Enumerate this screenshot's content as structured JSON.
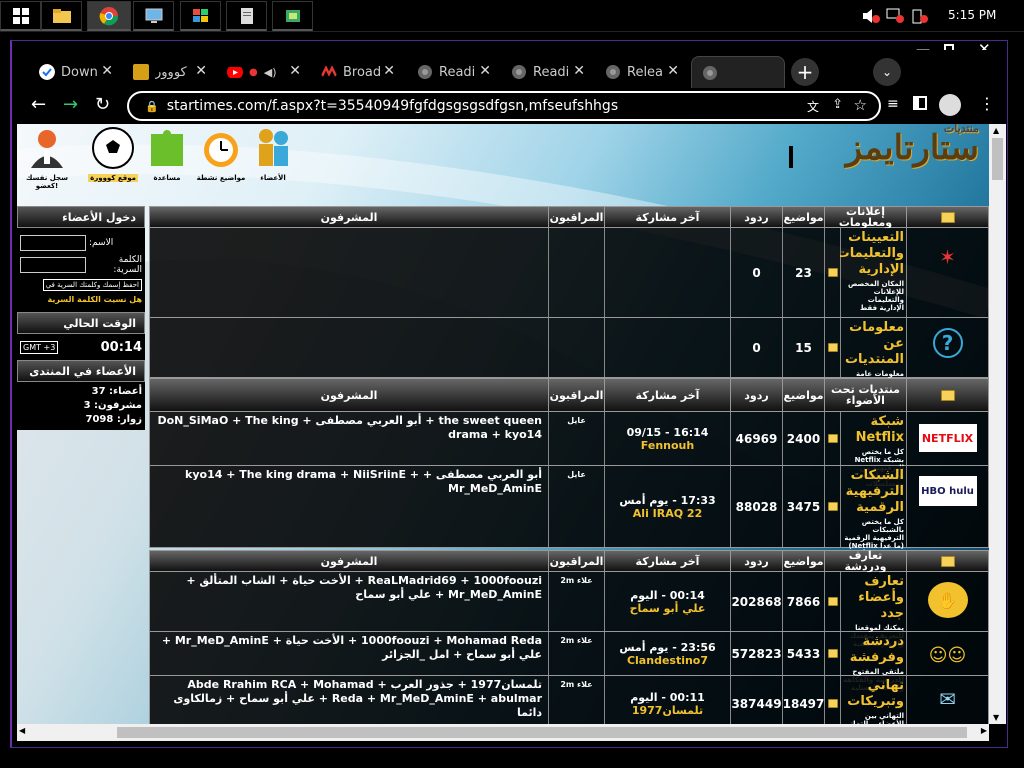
{
  "taskbar": {
    "time": "5:15 PM"
  },
  "browser": {
    "tabs": [
      {
        "title": "Down",
        "icon": "check-circle-icon",
        "color": "#1a73e8"
      },
      {
        "title": "كووور",
        "icon": "koora-icon",
        "color": "#d4a017"
      },
      {
        "title": "",
        "icon": "youtube-icon",
        "color": "#ff0000"
      },
      {
        "title": "Broad",
        "icon": "broadcast-icon",
        "color": "#e53935"
      },
      {
        "title": "Readi",
        "icon": "globe-icon",
        "color": "#777777"
      },
      {
        "title": "Readi",
        "icon": "globe-icon",
        "color": "#777777"
      },
      {
        "title": "Relea",
        "icon": "globe-icon",
        "color": "#777777"
      },
      {
        "title": "",
        "icon": "globe-icon",
        "color": "#777777"
      }
    ],
    "url": "startimes.com/f.aspx?t=35540949fgfdgsgsgsdfgsn,mfseufshhgs"
  },
  "site": {
    "logo_small": "منتديات",
    "logo": "ستارتايمز",
    "top_icons": [
      {
        "label": "الأعضاء",
        "icon": "members-icon",
        "color": "#e0a21a"
      },
      {
        "label": "مواضيع نشطة",
        "icon": "alarm-clock-icon",
        "color": "#f08b1a"
      },
      {
        "label": "مساعدة",
        "icon": "puzzle-icon",
        "color": "#6bbf2a"
      },
      {
        "label": "موقع كووورة",
        "icon": "football-icon",
        "color": "#ffffff"
      },
      {
        "label": "سجل نفسك كعضو!",
        "icon": "user-register-icon",
        "color": "#e8662a"
      }
    ]
  },
  "sidebar": {
    "login_title": "دخول الأعضاء",
    "name_label": "الاسم:",
    "password_label": "الكلمة السرية:",
    "remember_label": "احفظ إسمك وكلمتك السرية في",
    "forgot_label": "هل نسيت الكلمة السرية",
    "time_title": "الوقت الحالي",
    "time_value": "00:14",
    "gmt_label": "GMT +3",
    "online_title": "الأعضاء في المنتدى",
    "members_label": "أعضاء:",
    "members_value": "37",
    "supervisors_label": "مشرفون:",
    "supervisors_value": "3",
    "visitors_label": "زوار:",
    "visitors_value": "7098"
  },
  "columns": {
    "topics": "مواضيع",
    "replies": "ردود",
    "last_post": "آخر مشاركة",
    "moderators": "المراقبون",
    "managers": "المشرفون"
  },
  "sections": [
    {
      "title": "إعلانات ومعلومات",
      "forums": [
        {
          "name": "التعيينات والتعليمات الإدارية",
          "desc": "المكان المخصص للإعلانات والتعليمات الإدارية فقط",
          "icon": "announcement-icon",
          "icon_text": "",
          "topics": "23",
          "replies": "0",
          "last_date": "",
          "last_user": "",
          "moderator": "",
          "managers": ""
        },
        {
          "name": "معلومات عن المنتديات",
          "desc": "معلومات عامة عن الإدارة للزوار والأعضاء الكرام",
          "icon": "question-icon",
          "icon_text": "?",
          "topics": "15",
          "replies": "0",
          "last_date": "",
          "last_user": "",
          "moderator": "",
          "managers": ""
        }
      ]
    },
    {
      "title": "منتديات تحت الأضواء",
      "forums": [
        {
          "name": "شبكة Netflix",
          "desc": "كل ما يختص بشبكة Netflix الترفيهية من برامج وأفلام ومسلسلات",
          "icon": "netflix-icon",
          "icon_text": "NETFLIX",
          "topics": "2400",
          "replies": "46969",
          "last_date": "09/15 - 16:14",
          "last_user": "Fennouh",
          "moderator": "عايل",
          "managers": "the sweet queen + أبو العربي مصطفى + DoN_SiMaO + The king drama + kyo14"
        },
        {
          "name": "الشبكات الترفيهية الرقمية",
          "desc": "كل ما يختص بالشبكات الترفيهية الرقمية (ما عدا Netflix) من برامج وأفلام ومسلسلات",
          "icon": "streaming-services-icon",
          "icon_text": "HBO hulu",
          "topics": "3475",
          "replies": "88028",
          "last_date": "17:33 - يوم أمس",
          "last_user": "Ali IRAQ 22",
          "moderator": "عايل",
          "managers": "أبو العربي مصطفى + kyo14 + The king drama + NiiSriinE + Mr_MeD_AminE"
        }
      ]
    },
    {
      "title": "تعارف ودردشة",
      "forums": [
        {
          "name": "تعارف وأعضاء جدد",
          "desc": "يمكنك لموقعنا للتعريف بنفسك والتعارف ببقية",
          "icon": "handshake-icon",
          "icon_text": "",
          "topics": "7866",
          "replies": "202868",
          "last_date": "00:14 - اليوم",
          "last_user": "علي أبو سماح",
          "moderator": "علاء 2m",
          "managers": "ReaLMadrid69 + 1000foouzi + الأخت حياة + الشاب المتألق + Mr_MeD_AminE + علي أبو سماح"
        },
        {
          "name": "دردشة وفرفشة",
          "desc": "ملتقى المفتوح للدردشة والفكاهة والنكت المسلية",
          "icon": "chat-icon",
          "icon_text": "",
          "topics": "5433",
          "replies": "572823",
          "last_date": "23:56 - يوم أمس",
          "last_user": "Clandestino7",
          "moderator": "علاء 2m",
          "managers": "1000foouzi + Mohamad Reda + الأخت حياة + Mr_MeD_AminE + علي أبو سماح + امل _الجزائر"
        },
        {
          "name": "تهاني وتبريكات",
          "desc": "التهاني بين الأعضاء .. التهاني للمشرفين الجدد..",
          "icon": "congrats-icon",
          "icon_text": "",
          "topics": "18497",
          "replies": "387449",
          "last_date": "00:11 - اليوم",
          "last_user": "تلمسان1977",
          "moderator": "علاء 2m",
          "managers": "تلمسان1977 + جذور العرب + Abde Rrahim RCA + Mohamad Reda + Mr_MeD_AminE + abulmar + علي أبو سماح + زمالكاوى دائما"
        }
      ]
    }
  ]
}
